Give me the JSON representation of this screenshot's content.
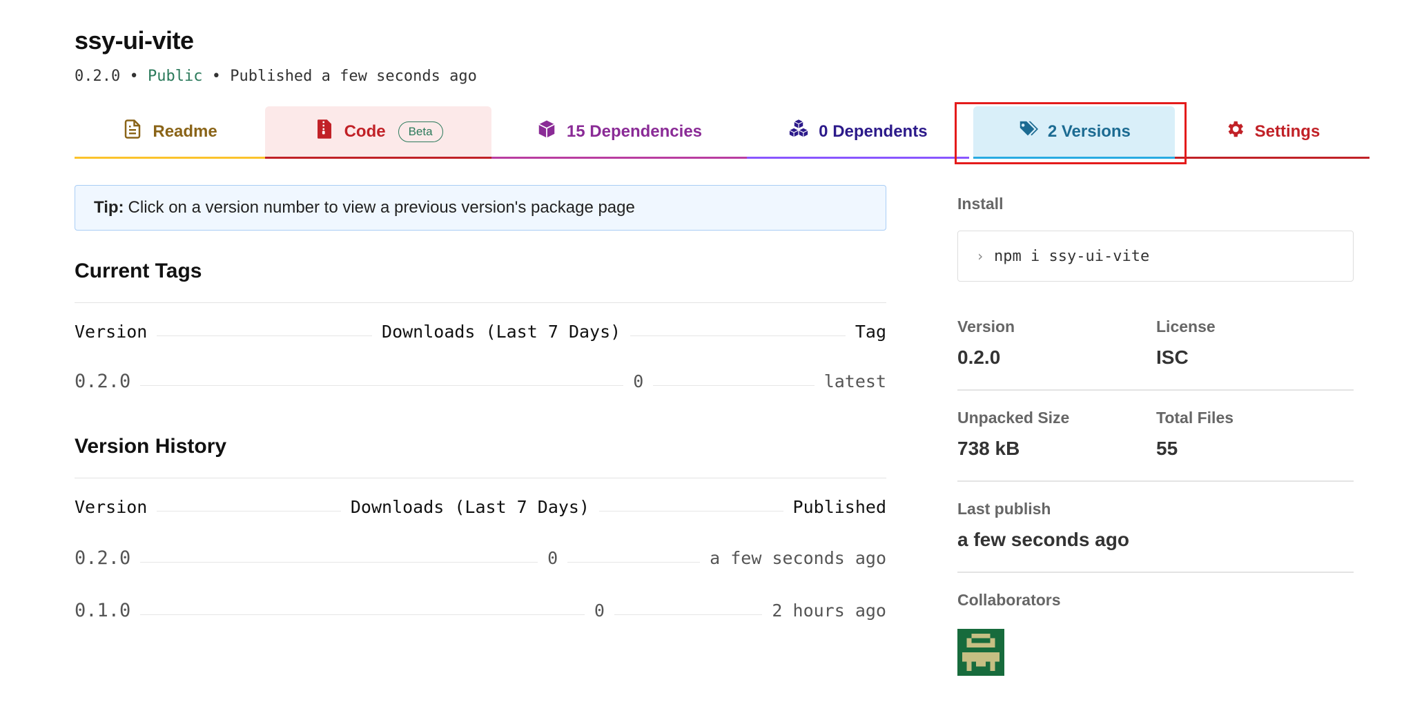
{
  "package": {
    "name": "ssy-ui-vite",
    "version": "0.2.0",
    "sep1": "•",
    "visibility": "Public",
    "sep2": "•",
    "published": "Published a few seconds ago"
  },
  "tabs": [
    {
      "label": "Readme",
      "icon": "file-text-icon",
      "color": "#8a6418"
    },
    {
      "label": "Code",
      "icon": "file-zip-icon",
      "badge": "Beta",
      "color": "#c12127"
    },
    {
      "label": "15 Dependencies",
      "icon": "box-icon",
      "color": "#8a2b96"
    },
    {
      "label": "0 Dependents",
      "icon": "boxes-icon",
      "color": "#2c1a8a"
    },
    {
      "label": "2 Versions",
      "icon": "tags-icon",
      "color": "#1c6b92",
      "selected": true
    },
    {
      "label": "Settings",
      "icon": "gear-icon",
      "color": "#c12127"
    }
  ],
  "tip": {
    "prefix": "Tip:",
    "text": "Click on a version number to view a previous version's package page"
  },
  "current_tags": {
    "title": "Current Tags",
    "headers": [
      "Version",
      "Downloads (Last 7 Days)",
      "Tag"
    ],
    "rows": [
      {
        "version": "0.2.0",
        "downloads": "0",
        "tag": "latest"
      }
    ]
  },
  "version_history": {
    "title": "Version History",
    "headers": [
      "Version",
      "Downloads (Last 7 Days)",
      "Published"
    ],
    "rows": [
      {
        "version": "0.2.0",
        "downloads": "0",
        "published": "a few seconds ago"
      },
      {
        "version": "0.1.0",
        "downloads": "0",
        "published": "2 hours ago"
      }
    ]
  },
  "sidebar": {
    "install_label": "Install",
    "install_command": "npm i ssy-ui-vite",
    "version_label": "Version",
    "version_value": "0.2.0",
    "license_label": "License",
    "license_value": "ISC",
    "unpacked_label": "Unpacked Size",
    "unpacked_value": "738 kB",
    "files_label": "Total Files",
    "files_value": "55",
    "last_publish_label": "Last publish",
    "last_publish_value": "a few seconds ago",
    "collaborators_label": "Collaborators"
  },
  "colors": {
    "accent_highlight": "#e41b1b",
    "avatar_bg": "#176b3c",
    "avatar_fg": "#c6bf83"
  }
}
